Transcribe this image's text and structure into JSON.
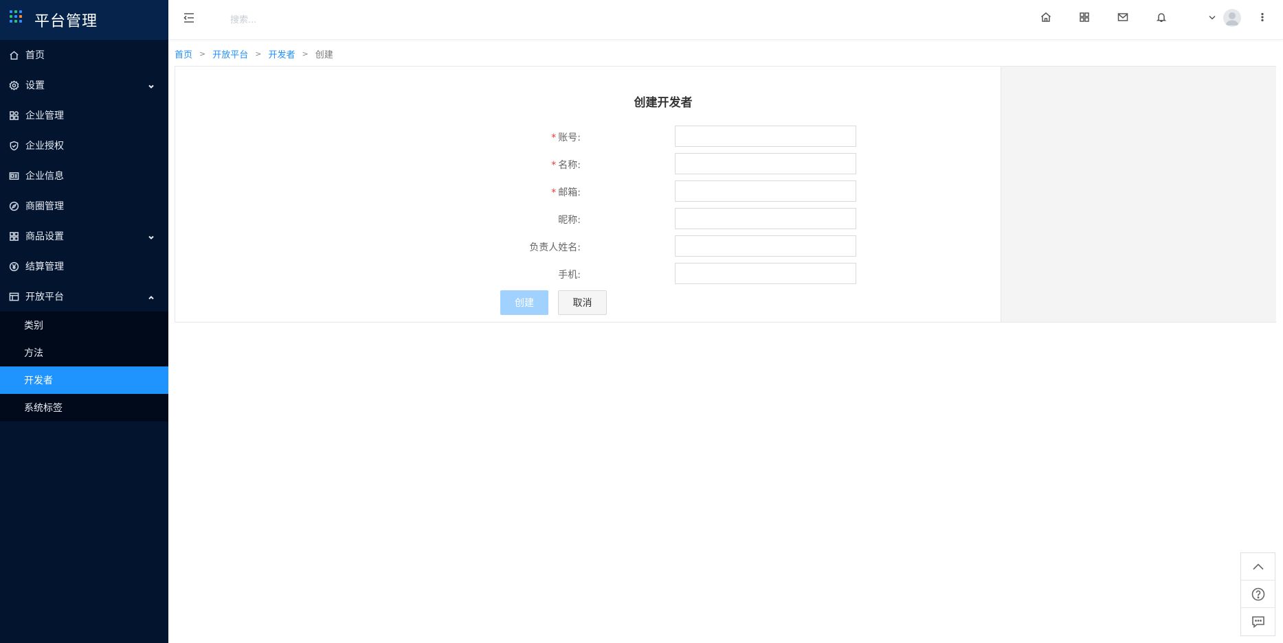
{
  "app": {
    "title": "平台管理"
  },
  "sidebar": {
    "items": [
      {
        "label": "首页",
        "icon": "home-icon"
      },
      {
        "label": "设置",
        "icon": "gear-icon",
        "expandable": true
      },
      {
        "label": "企业管理",
        "icon": "cubes-icon"
      },
      {
        "label": "企业授权",
        "icon": "shield-icon"
      },
      {
        "label": "企业信息",
        "icon": "id-card-icon"
      },
      {
        "label": "商圈管理",
        "icon": "compass-icon"
      },
      {
        "label": "商品设置",
        "icon": "grid-icon",
        "expandable": true
      },
      {
        "label": "结算管理",
        "icon": "yen-icon"
      },
      {
        "label": "开放平台",
        "icon": "table-icon",
        "expanded": true
      }
    ],
    "submenu": [
      {
        "label": "类别"
      },
      {
        "label": "方法"
      },
      {
        "label": "开发者",
        "active": true
      },
      {
        "label": "系统标签"
      }
    ]
  },
  "header": {
    "search_placeholder": "搜索...",
    "icons": [
      "home-icon",
      "apps-icon",
      "mail-icon",
      "bell-icon",
      "chevron-down-icon",
      "avatar",
      "more-icon"
    ]
  },
  "breadcrumb": {
    "items": [
      "首页",
      "开放平台",
      "开发者"
    ],
    "separator": ">",
    "current": "创建"
  },
  "form": {
    "title": "创建开发者",
    "fields": [
      {
        "label": "账号:",
        "required": true,
        "value": ""
      },
      {
        "label": "名称:",
        "required": true,
        "value": ""
      },
      {
        "label": "邮箱:",
        "required": true,
        "value": ""
      },
      {
        "label": "昵称:",
        "required": false,
        "value": ""
      },
      {
        "label": "负责人姓名:",
        "required": false,
        "value": ""
      },
      {
        "label": "手机:",
        "required": false,
        "value": ""
      }
    ],
    "required_mark": "*",
    "create_label": "创建",
    "cancel_label": "取消"
  },
  "floatbar": {
    "icons": [
      "arrow-up-icon",
      "help-icon",
      "feedback-icon"
    ]
  },
  "colors": {
    "sidebar_bg": "#03142e",
    "brand_bg": "#06244b",
    "active": "#1f94ff",
    "link": "#1f8fff",
    "create_btn": "#a1d2ff",
    "required": "#e63c3c"
  }
}
